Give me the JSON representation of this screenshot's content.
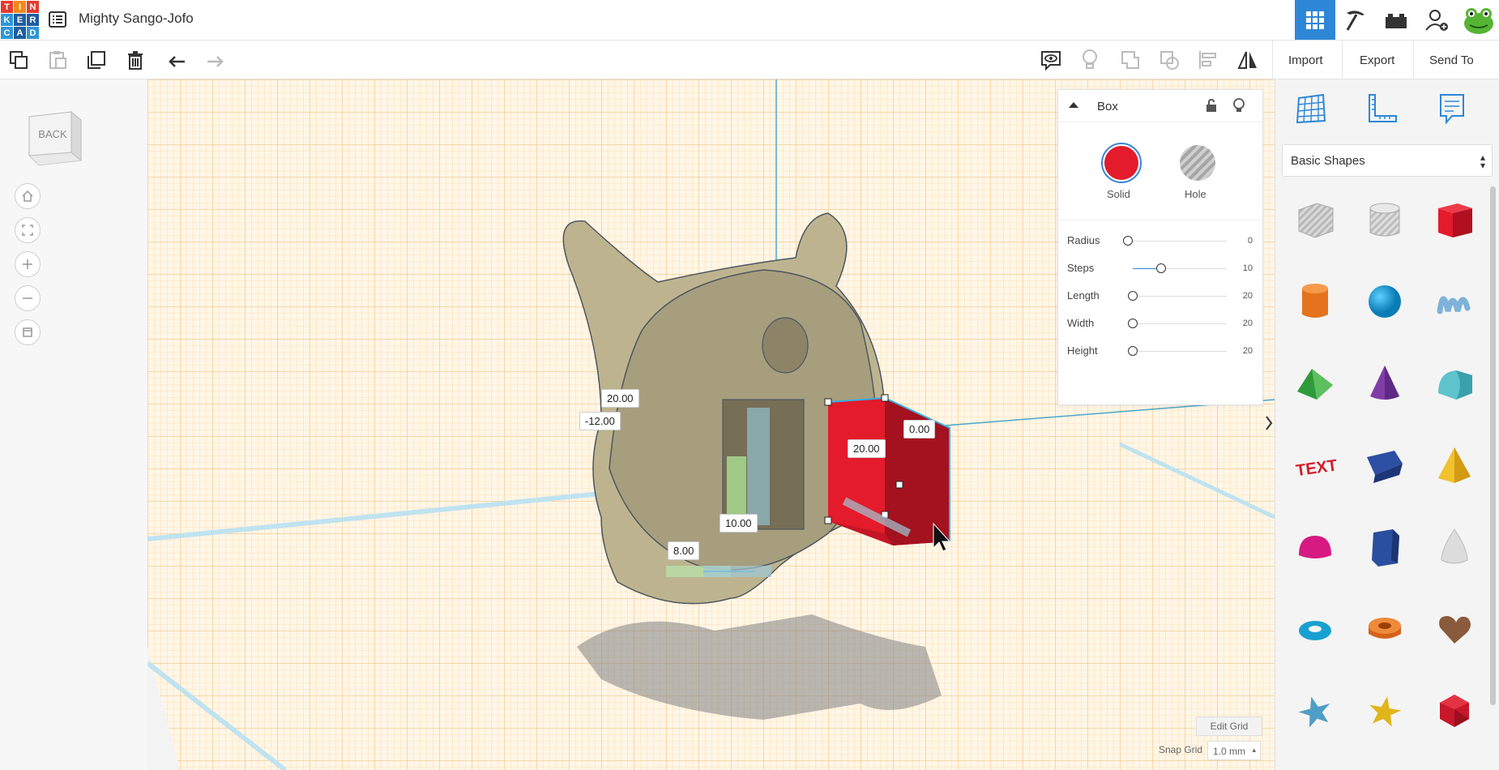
{
  "app": {
    "logo_letters": [
      "T",
      "I",
      "N",
      "K",
      "E",
      "R",
      "C",
      "A",
      "D"
    ],
    "logo_colors": [
      "#e53b2f",
      "#f08a1c",
      "#e53b2f",
      "#2f96d6",
      "#1d5e9e",
      "#1d5e9e",
      "#2f96d6",
      "#1d5e9e",
      "#2f96d6"
    ],
    "design_title": "Mighty Sango-Jofo"
  },
  "toolbar": {
    "import_label": "Import",
    "export_label": "Export",
    "send_to_label": "Send To"
  },
  "viewcube": {
    "label": "BACK"
  },
  "inspector": {
    "title": "Box",
    "solid_label": "Solid",
    "hole_label": "Hole",
    "solid_color": "#e31b2b",
    "params": [
      {
        "label": "Radius",
        "value": "0",
        "fraction": 0.0
      },
      {
        "label": "Steps",
        "value": "10",
        "fraction": 0.35
      },
      {
        "label": "Length",
        "value": "20",
        "fraction": 0.05
      },
      {
        "label": "Width",
        "value": "20",
        "fraction": 0.05
      },
      {
        "label": "Height",
        "value": "20",
        "fraction": 0.05
      }
    ]
  },
  "shapes_panel": {
    "selected_library": "Basic Shapes",
    "shapes": [
      "box-hole-icon",
      "cylinder-hole-icon",
      "box-icon",
      "cylinder-icon",
      "sphere-icon",
      "scribble-icon",
      "roof-icon",
      "cone-icon",
      "round-roof-icon",
      "text-icon",
      "wedge-icon",
      "pyramid-icon",
      "half-sphere-icon",
      "polygon-icon",
      "paraboloid-icon",
      "torus-icon",
      "tube-icon",
      "heart-icon",
      "star-icon",
      "star-gold-icon",
      "icosahedron-icon"
    ]
  },
  "canvas": {
    "dims": {
      "d1": "20.00",
      "d2": "-12.00",
      "d3": "0.00",
      "d4": "20.00",
      "d5": "10.00",
      "d6": "8.00"
    },
    "edit_grid_label": "Edit Grid",
    "snap_grid_label": "Snap Grid",
    "snap_grid_value": "1.0 mm"
  }
}
